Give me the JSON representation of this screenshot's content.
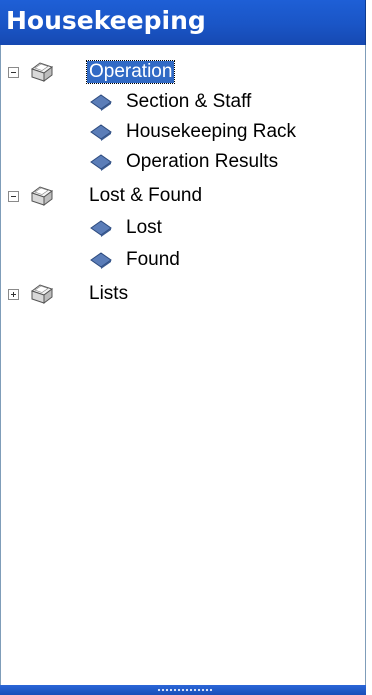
{
  "panel": {
    "title": "Housekeeping"
  },
  "tree": {
    "nodes": [
      {
        "label": "Operation",
        "expanded": true,
        "selected": true,
        "icon": "folder-icon",
        "children": [
          {
            "label": "Section & Staff",
            "icon": "item-icon"
          },
          {
            "label": "Housekeeping Rack",
            "icon": "item-icon"
          },
          {
            "label": "Operation Results",
            "icon": "item-icon"
          }
        ]
      },
      {
        "label": "Lost & Found",
        "expanded": true,
        "selected": false,
        "icon": "folder-icon",
        "children": [
          {
            "label": "Lost",
            "icon": "item-icon"
          },
          {
            "label": "Found",
            "icon": "item-icon"
          }
        ]
      },
      {
        "label": "Lists",
        "expanded": false,
        "selected": false,
        "icon": "folder-icon",
        "children": []
      }
    ]
  },
  "colors": {
    "header": "#1a55c6",
    "selection": "#316ac5",
    "item_icon": "#4f6fa8"
  }
}
